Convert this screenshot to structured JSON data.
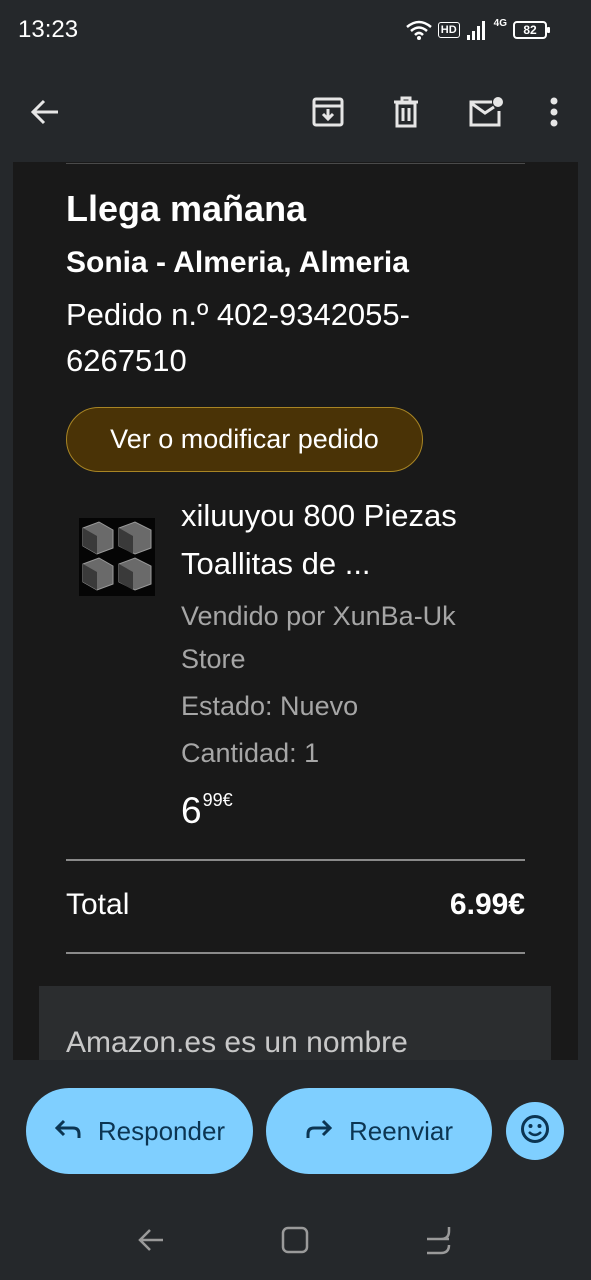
{
  "status_bar": {
    "time": "13:23",
    "hd_label": "HD",
    "network_label": "4G",
    "battery_level": "82",
    "icons": [
      "wifi-icon",
      "signal-icon",
      "battery-icon"
    ]
  },
  "toolbar": {
    "icons": [
      "back-arrow-icon",
      "archive-icon",
      "delete-icon",
      "mark-unread-icon",
      "more-vert-icon"
    ]
  },
  "email": {
    "delivery_title": "Llega mañana",
    "recipient": "Sonia - Almeria, Almeria",
    "order_number": "Pedido n.º 402-9342055-6267510",
    "order_button_label": "Ver o modificar pedido",
    "product": {
      "name": "xiluuyou 800 Piezas Toallitas de ...",
      "seller": "Vendido por XunBa-Uk Store",
      "condition": "Estado: Nuevo",
      "quantity": "Cantidad: 1",
      "price_whole": "6",
      "price_fraction": "99€"
    },
    "total_label": "Total",
    "total_value": "6.99€",
    "footer_text": "Amazon.es es un nombre"
  },
  "actions": {
    "reply_label": "Responder",
    "forward_label": "Reenviar"
  },
  "colors": {
    "background": "#25282b",
    "email_background": "#191919",
    "button_fill": "#4a3306",
    "button_border": "#a88524",
    "pill_fill": "#7fcfff",
    "pill_text": "#0c3552"
  }
}
